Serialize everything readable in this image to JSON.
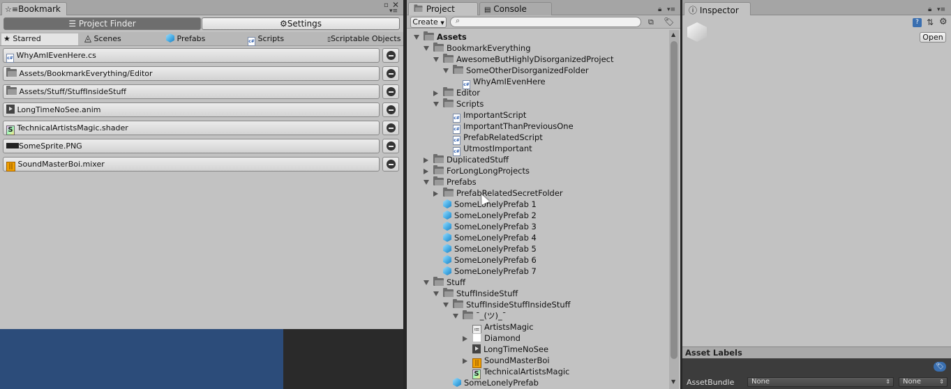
{
  "bookmark": {
    "title": "Bookmark",
    "modes": [
      "Project Finder",
      "Settings"
    ],
    "categories": [
      "Starred",
      "Scenes",
      "Prefabs",
      "Scripts",
      "Scriptable Objects"
    ],
    "items": [
      {
        "label": "WhyAmIEvenHere.cs",
        "icon": "csharp-script-icon"
      },
      {
        "label": "Assets/BookmarkEverything/Editor",
        "icon": "folder-icon"
      },
      {
        "label": "Assets/Stuff/StuffInsideStuff",
        "icon": "folder-icon"
      },
      {
        "label": "LongTimeNoSee.anim",
        "icon": "animation-icon"
      },
      {
        "label": "TechnicalArtistsMagic.shader",
        "icon": "shader-icon"
      },
      {
        "label": "SomeSprite.PNG",
        "icon": "sprite-icon"
      },
      {
        "label": "SoundMasterBoi.mixer",
        "icon": "audio-mixer-icon"
      }
    ]
  },
  "project": {
    "tabs": [
      "Project",
      "Console"
    ],
    "create_label": "Create",
    "search_placeholder": "",
    "tree": [
      {
        "label": "Assets",
        "depth": 0,
        "state": "open",
        "icon": "folder",
        "bold": true
      },
      {
        "label": "BookmarkEverything",
        "depth": 1,
        "state": "open",
        "icon": "folder"
      },
      {
        "label": "AwesomeButHighlyDisorganizedProject",
        "depth": 2,
        "state": "open",
        "icon": "folder"
      },
      {
        "label": "SomeOtherDisorganizedFolder",
        "depth": 3,
        "state": "open",
        "icon": "folder"
      },
      {
        "label": "WhyAmIEvenHere",
        "depth": 4,
        "state": "leaf",
        "icon": "cs"
      },
      {
        "label": "Editor",
        "depth": 2,
        "state": "closed",
        "icon": "folder"
      },
      {
        "label": "Scripts",
        "depth": 2,
        "state": "open",
        "icon": "folder"
      },
      {
        "label": "ImportantScript",
        "depth": 3,
        "state": "leaf",
        "icon": "cs"
      },
      {
        "label": "ImportantThanPreviousOne",
        "depth": 3,
        "state": "leaf",
        "icon": "cs"
      },
      {
        "label": "PrefabRelatedScript",
        "depth": 3,
        "state": "leaf",
        "icon": "cs"
      },
      {
        "label": "UtmostImportant",
        "depth": 3,
        "state": "leaf",
        "icon": "cs"
      },
      {
        "label": "DuplicatedStuff",
        "depth": 1,
        "state": "closed",
        "icon": "folder"
      },
      {
        "label": "ForLongLongProjects",
        "depth": 1,
        "state": "closed",
        "icon": "folder"
      },
      {
        "label": "Prefabs",
        "depth": 1,
        "state": "open",
        "icon": "folder"
      },
      {
        "label": "PrefabRelatedSecretFolder",
        "depth": 2,
        "state": "closed",
        "icon": "folder"
      },
      {
        "label": "SomeLonelyPrefab 1",
        "depth": 2,
        "state": "leaf",
        "icon": "cube"
      },
      {
        "label": "SomeLonelyPrefab 2",
        "depth": 2,
        "state": "leaf",
        "icon": "cube"
      },
      {
        "label": "SomeLonelyPrefab 3",
        "depth": 2,
        "state": "leaf",
        "icon": "cube"
      },
      {
        "label": "SomeLonelyPrefab 4",
        "depth": 2,
        "state": "leaf",
        "icon": "cube"
      },
      {
        "label": "SomeLonelyPrefab 5",
        "depth": 2,
        "state": "leaf",
        "icon": "cube"
      },
      {
        "label": "SomeLonelyPrefab 6",
        "depth": 2,
        "state": "leaf",
        "icon": "cube"
      },
      {
        "label": "SomeLonelyPrefab 7",
        "depth": 2,
        "state": "leaf",
        "icon": "cube"
      },
      {
        "label": "Stuff",
        "depth": 1,
        "state": "open",
        "icon": "folder"
      },
      {
        "label": "StuffInsideStuff",
        "depth": 2,
        "state": "open",
        "icon": "folder"
      },
      {
        "label": "StuffInsideStuffInsideStuff",
        "depth": 3,
        "state": "open",
        "icon": "folder"
      },
      {
        "label": "¯_(ツ)_¯",
        "depth": 4,
        "state": "open",
        "icon": "folder"
      },
      {
        "label": "ArtistsMagic",
        "depth": 5,
        "state": "leaf",
        "icon": "am"
      },
      {
        "label": "Diamond",
        "depth": 5,
        "state": "closed",
        "icon": "white"
      },
      {
        "label": "LongTimeNoSee",
        "depth": 5,
        "state": "leaf",
        "icon": "anim"
      },
      {
        "label": "SoundMasterBoi",
        "depth": 5,
        "state": "closed",
        "icon": "mixer"
      },
      {
        "label": "TechnicalArtistsMagic",
        "depth": 5,
        "state": "leaf",
        "icon": "shader"
      },
      {
        "label": "SomeLonelyPrefab",
        "depth": 3,
        "state": "leaf",
        "icon": "cube"
      }
    ]
  },
  "inspector": {
    "tab": "Inspector",
    "open_label": "Open",
    "asset_labels_title": "Asset Labels",
    "assetbundle_label": "AssetBundle",
    "assetbundle_value": "None",
    "assetbundle_variant": "None"
  }
}
